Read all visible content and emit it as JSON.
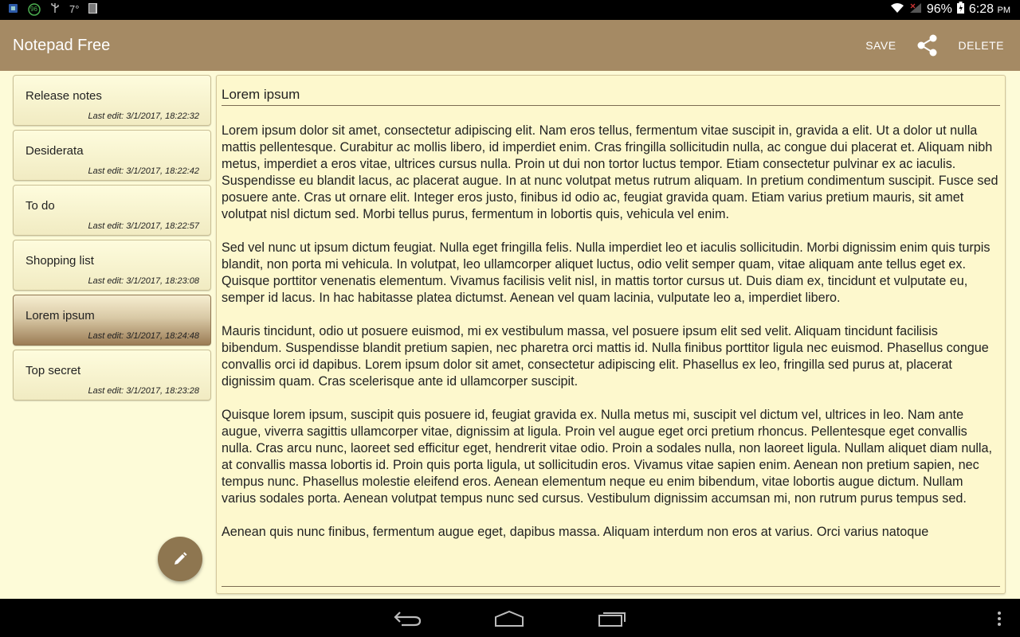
{
  "statusbar": {
    "badge_number": "96",
    "temperature": "7°",
    "battery": "96%",
    "time": "6:28",
    "ampm": "PM",
    "icons": [
      "sim-icon",
      "sync-badge-icon",
      "usb-icon",
      "temperature-text",
      "barcode-icon",
      "wifi-icon",
      "signal-icon",
      "battery-icon"
    ]
  },
  "appbar": {
    "title": "Notepad Free",
    "save_label": "SAVE",
    "share_icon": "share-icon",
    "delete_label": "DELETE"
  },
  "notes": [
    {
      "title": "Release notes",
      "date": "Last edit: 3/1/2017, 18:22:32",
      "selected": false
    },
    {
      "title": "Desiderata",
      "date": "Last edit: 3/1/2017, 18:22:42",
      "selected": false
    },
    {
      "title": "To do",
      "date": "Last edit: 3/1/2017, 18:22:57",
      "selected": false
    },
    {
      "title": "Shopping list",
      "date": "Last edit: 3/1/2017, 18:23:08",
      "selected": false
    },
    {
      "title": "Lorem ipsum",
      "date": "Last edit: 3/1/2017, 18:24:48",
      "selected": true
    },
    {
      "title": "Top secret",
      "date": "Last edit: 3/1/2017, 18:23:28",
      "selected": false
    }
  ],
  "fab_icon": "pencil-icon",
  "editor": {
    "title": "Lorem ipsum",
    "paragraphs": [
      "Lorem ipsum dolor sit amet, consectetur adipiscing elit. Nam eros tellus, fermentum vitae suscipit in, gravida a elit. Ut a dolor ut nulla mattis pellentesque. Curabitur ac mollis libero, id imperdiet enim. Cras fringilla sollicitudin nulla, ac congue dui placerat et. Aliquam nibh metus, imperdiet a eros vitae, ultrices cursus nulla. Proin ut dui non tortor luctus tempor. Etiam consectetur pulvinar ex ac iaculis. Suspendisse eu blandit lacus, ac placerat augue. In at nunc volutpat metus rutrum aliquam. In pretium condimentum suscipit. Fusce sed posuere ante. Cras ut ornare elit. Integer eros justo, finibus id odio ac, feugiat gravida quam. Etiam varius pretium mauris, sit amet volutpat nisl dictum sed. Morbi tellus purus, fermentum in lobortis quis, vehicula vel enim.",
      "Sed vel nunc ut ipsum dictum feugiat. Nulla eget fringilla felis. Nulla imperdiet leo et iaculis sollicitudin. Morbi dignissim enim quis turpis blandit, non porta mi vehicula. In volutpat, leo ullamcorper aliquet luctus, odio velit semper quam, vitae aliquam ante tellus eget ex. Quisque porttitor venenatis elementum. Vivamus facilisis velit nisl, in mattis tortor cursus ut. Duis diam ex, tincidunt et vulputate eu, semper id lacus. In hac habitasse platea dictumst. Aenean vel quam lacinia, vulputate leo a, imperdiet libero.",
      "Mauris tincidunt, odio ut posuere euismod, mi ex vestibulum massa, vel posuere ipsum elit sed velit. Aliquam tincidunt facilisis bibendum. Suspendisse blandit pretium sapien, nec pharetra orci mattis id. Nulla finibus porttitor ligula nec euismod. Phasellus congue convallis orci id dapibus. Lorem ipsum dolor sit amet, consectetur adipiscing elit. Phasellus ex leo, fringilla sed purus at, placerat dignissim quam. Cras scelerisque ante id ullamcorper suscipit.",
      "Quisque lorem ipsum, suscipit quis posuere id, feugiat gravida ex. Nulla metus mi, suscipit vel dictum vel, ultrices in leo. Nam ante augue, viverra sagittis ullamcorper vitae, dignissim at ligula. Proin vel augue eget orci pretium rhoncus. Pellentesque eget convallis nulla. Cras arcu nunc, laoreet sed efficitur eget, hendrerit vitae odio. Proin a sodales nulla, non laoreet ligula. Nullam aliquet diam nulla, at convallis massa lobortis id. Proin quis porta ligula, ut sollicitudin eros. Vivamus vitae sapien enim. Aenean non pretium sapien, nec tempus nunc. Phasellus molestie eleifend eros. Aenean elementum neque eu enim bibendum, vitae lobortis augue dictum. Nullam varius sodales porta. Aenean volutpat tempus nunc sed cursus. Vestibulum dignissim accumsan mi, non rutrum purus tempus sed.",
      "Aenean quis nunc finibus, fermentum augue eget, dapibus massa. Aliquam interdum non eros at varius. Orci varius natoque"
    ]
  },
  "navbar": {
    "icons": [
      "back-icon",
      "home-icon",
      "recent-apps-icon",
      "overflow-menu-icon"
    ]
  }
}
